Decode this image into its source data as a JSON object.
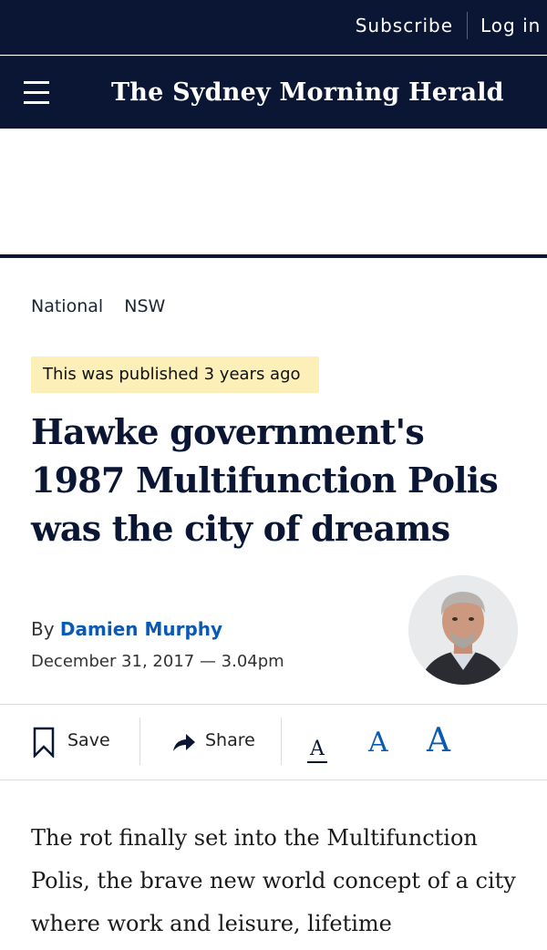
{
  "top_bar": {
    "subscribe_label": "Subscribe",
    "login_label": "Log in"
  },
  "nav_bar": {
    "menu_icon": "hamburger-menu-icon",
    "masthead": "The Sydney Morning Herald"
  },
  "breadcrumb": {
    "items": [
      {
        "label": "National"
      },
      {
        "label": "NSW"
      }
    ]
  },
  "notice": {
    "text": "This was published 3 years ago"
  },
  "article": {
    "headline": "Hawke government's 1987 Multifunction Polis was the city of dreams",
    "byline_prefix": "By",
    "author": "Damien Murphy",
    "date": "December 31, 2017 — 3.04pm",
    "body_excerpt": "The rot finally set into the Multifunction Polis, the brave new world concept of a city where work and leisure, lifetime"
  },
  "toolbar": {
    "save_label": "Save",
    "save_icon": "bookmark-icon",
    "share_label": "Share",
    "share_icon": "share-arrow-icon",
    "font_sizes": [
      "A",
      "A",
      "A"
    ]
  },
  "colors": {
    "navy": "#0a1633",
    "link_blue": "#0a5ab5",
    "notice_bg": "#fcefb8"
  }
}
